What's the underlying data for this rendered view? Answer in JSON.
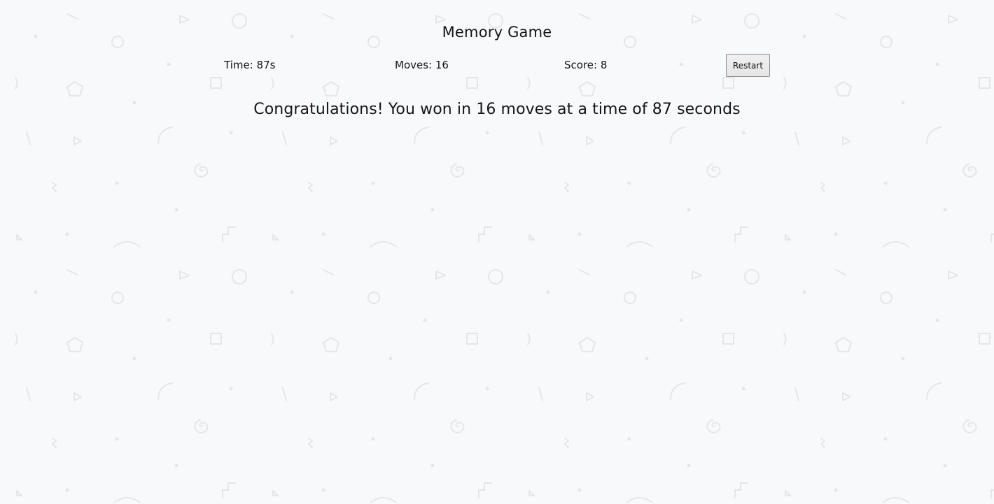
{
  "game": {
    "title": "Memory Game",
    "time_text": "Time: 87s",
    "moves_text": "Moves: 16",
    "score_text": "Score: 8",
    "restart_label": "Restart",
    "win_message": "Congratulations! You won in 16 moves at a time of 87 seconds"
  },
  "colors": {
    "background": "#f8f9fb",
    "pattern_stroke": "#e4e6ea",
    "text": "#151515",
    "button_border": "#8e8e8e"
  }
}
